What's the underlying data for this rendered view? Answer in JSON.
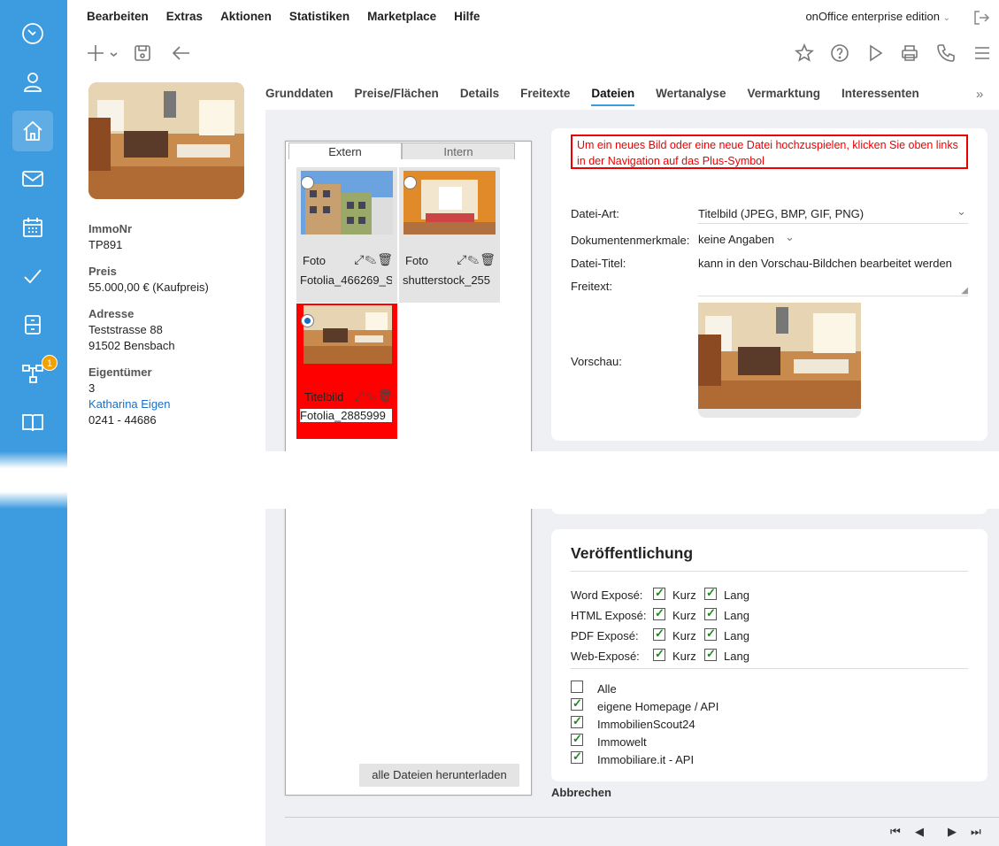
{
  "menu": {
    "items": [
      "Bearbeiten",
      "Extras",
      "Aktionen",
      "Statistiken",
      "Marketplace",
      "Hilfe"
    ],
    "edition": "onOffice enterprise edition"
  },
  "rail": {
    "badge_count": "1",
    "icons": [
      "dashboard-icon",
      "contact-icon",
      "home-icon",
      "mail-icon",
      "calendar-icon",
      "check-icon",
      "archive-icon",
      "process-icon",
      "book-icon",
      "chart-icon"
    ]
  },
  "info": {
    "immonr_label": "ImmoNr",
    "immonr": "TP891",
    "preis_label": "Preis",
    "preis": "55.000,00 € (Kaufpreis)",
    "adresse_label": "Adresse",
    "adresse_street": "Teststrasse 88",
    "adresse_city": "91502 Bensbach",
    "eigentuemer_label": "Eigentümer",
    "eigentuemer_nr": "3",
    "eigentuemer_name": "Katharina Eigen",
    "eigentuemer_phone": "0241 - 44686"
  },
  "tabs": [
    "Grunddaten",
    "Preise/Flächen",
    "Details",
    "Freitexte",
    "Dateien",
    "Wertanalyse",
    "Vermarktung",
    "Interessenten"
  ],
  "files": {
    "tab_extern": "Extern",
    "tab_intern": "Intern",
    "tiles": [
      {
        "kind": "Foto",
        "name": "Fotolia_466269_S"
      },
      {
        "kind": "Foto",
        "name": "shutterstock_255"
      },
      {
        "kind": "Titelbild",
        "name": "Fotolia_2885999"
      }
    ],
    "download_all": "alle Dateien herunterladen"
  },
  "detail": {
    "notice": "Um ein neues Bild oder eine neue Datei hochzuspielen, klicken Sie oben links in der Navigation auf das Plus-Symbol",
    "datei_art_label": "Datei-Art:",
    "datei_art": "Titelbild (JPEG, BMP, GIF, PNG)",
    "dok_label": "Dokumentenmerkmale:",
    "dok": "keine Angaben",
    "titel_label": "Datei-Titel:",
    "titel": "kann in den Vorschau-Bildchen bearbeitet werden",
    "freitext_label": "Freitext:",
    "vorschau_label": "Vorschau:"
  },
  "publication": {
    "title": "Veröffentlichung",
    "rows": [
      {
        "label": "Word Exposé:",
        "kurz": "Kurz",
        "lang": "Lang"
      },
      {
        "label": "HTML Exposé:",
        "kurz": "Kurz",
        "lang": "Lang"
      },
      {
        "label": "PDF Exposé:",
        "kurz": "Kurz",
        "lang": "Lang"
      },
      {
        "label": "Web-Exposé:",
        "kurz": "Kurz",
        "lang": "Lang"
      }
    ],
    "portals": [
      {
        "label": "Alle",
        "checked": false
      },
      {
        "label": "eigene Homepage / API",
        "checked": true
      },
      {
        "label": "ImmobilienScout24",
        "checked": true
      },
      {
        "label": "Immowelt",
        "checked": true
      },
      {
        "label": "Immobiliare.it - API",
        "checked": true
      }
    ]
  },
  "cancel_label": "Abbrechen"
}
